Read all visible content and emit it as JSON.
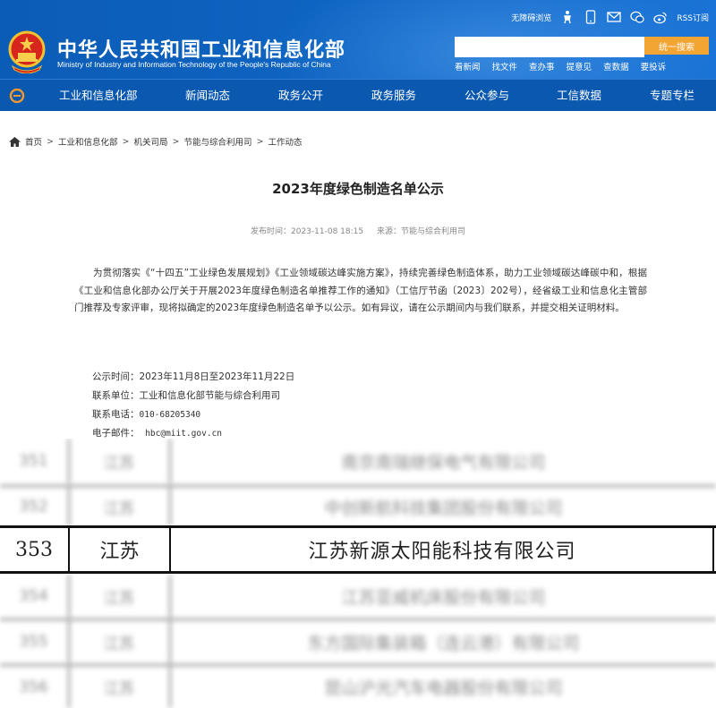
{
  "header": {
    "site_title": "中华人民共和国工业和信息化部",
    "site_subtitle": "Ministry of Industry and Information Technology of the People's Republic of China",
    "tools": {
      "accessibility": "无障碍浏览",
      "rss": "RSS订阅"
    },
    "icons": [
      "elder-mode-icon",
      "mobile-icon",
      "mail-icon",
      "wechat-icon",
      "weibo-icon",
      "rss-icon"
    ],
    "search": {
      "placeholder": "",
      "button_label": "统一搜索"
    },
    "quick_links": [
      "看新闻",
      "找文件",
      "查办事",
      "提意见",
      "查数据",
      "要投诉"
    ]
  },
  "nav": {
    "items": [
      "工业和信息化部",
      "新闻动态",
      "政务公开",
      "政务服务",
      "公众参与",
      "工信数据",
      "专题专栏"
    ]
  },
  "breadcrumb": [
    "首页",
    "工业和信息化部",
    "机关司局",
    "节能与综合利用司",
    "工作动态"
  ],
  "article": {
    "title": "2023年度绿色制造名单公示",
    "publish_time": "发布时间：2023-11-08 18:15",
    "source": "来源：节能与综合利用司",
    "paragraph": "为贯彻落实《“十四五”工业绿色发展规划》《工业领域碳达峰实施方案》，持续完善绿色制造体系，助力工业领域碳达峰碳中和，根据《工业和信息化部办公厅关于开展2023年度绿色制造名单推荐工作的通知》（工信厅节函〔2023〕202号），经省级工业和信息化主管部门推荐及专家评审，现将拟确定的2023年度绿色制造名单予以公示。如有异议，请在公示期间内与我们联系，并提交相关证明材料。",
    "info": {
      "period_label": "公示时间：",
      "period_value": "2023年11月8日至2023年11月22日",
      "unit_label": "联系单位：",
      "unit_value": "工业和信息化部节能与综合利用司",
      "phone_label": "联系电话：",
      "phone_value": "010-68205340",
      "email_label": "电子邮件：",
      "email_value": "hbc@miit.gov.cn"
    }
  },
  "table": {
    "focus_row": {
      "no": "353",
      "province": "江苏",
      "company": "江苏新源太阳能科技有限公司"
    },
    "blurred_rows": [
      {
        "no": "351",
        "province": "江苏",
        "company": "南京南瑞继保电气有限公司"
      },
      {
        "no": "352",
        "province": "江苏",
        "company": "中创新航科技集团股份有限公司"
      },
      {
        "no": "354",
        "province": "江苏",
        "company": "江苏亚威机床股份有限公司"
      },
      {
        "no": "355",
        "province": "江苏",
        "company": "东方国际集装箱（连云港）有限公司"
      },
      {
        "no": "356",
        "province": "江苏",
        "company": "昆山沪光汽车电器股份有限公司"
      }
    ]
  }
}
